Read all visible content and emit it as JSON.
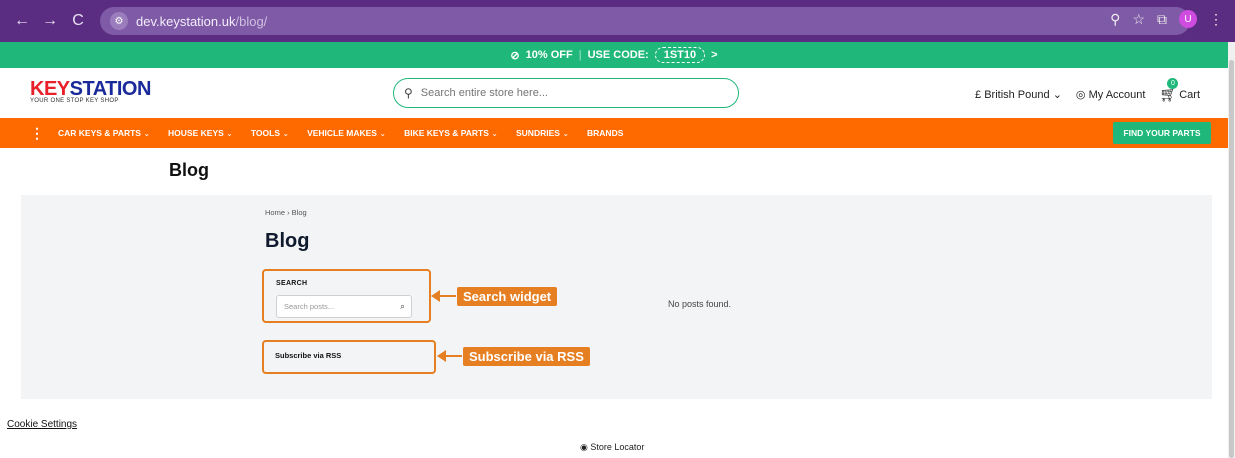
{
  "browser": {
    "back": "←",
    "forward": "→",
    "reload": "C",
    "url_domain": "dev.keystation.uk",
    "url_path": "/blog/",
    "profile_initial": "U"
  },
  "promo": {
    "offer": "10% OFF",
    "separator": "|",
    "code_label": "USE CODE:",
    "code": "1ST10",
    "arrow": ">"
  },
  "header": {
    "logo_key": "KEY",
    "logo_station": "STATION",
    "logo_tagline": "YOUR ONE STOP KEY SHOP",
    "search_placeholder": "Search entire store here...",
    "currency": "£ British Pound",
    "account": "My Account",
    "cart_label": "Cart",
    "cart_count": "0"
  },
  "menu": {
    "items": [
      {
        "label": "CAR KEYS & PARTS",
        "chev": "⌄"
      },
      {
        "label": "HOUSE KEYS",
        "chev": "⌄"
      },
      {
        "label": "TOOLS",
        "chev": "⌄"
      },
      {
        "label": "VEHICLE MAKES",
        "chev": "⌄"
      },
      {
        "label": "BIKE KEYS & PARTS",
        "chev": "⌄"
      },
      {
        "label": "SUNDRIES",
        "chev": "⌄"
      },
      {
        "label": "BRANDS",
        "chev": ""
      }
    ],
    "find_button": "FIND YOUR PARTS"
  },
  "page": {
    "title": "Blog",
    "breadcrumb": "Home › Blog",
    "heading": "Blog",
    "search_widget_label": "SEARCH",
    "search_widget_placeholder": "Search posts...",
    "rss_label": "Subscribe via RSS",
    "no_posts": "No posts found."
  },
  "annotations": {
    "search_widget": "Search widget",
    "rss": "Subscribe via RSS"
  },
  "footer": {
    "cookie_settings": "Cookie Settings",
    "store_locator": "Store Locator"
  },
  "colors": {
    "chrome": "#5a2d82",
    "promo_green": "#1fb87a",
    "menu_orange": "#ff6a00",
    "annotation_orange": "#e67e22"
  }
}
